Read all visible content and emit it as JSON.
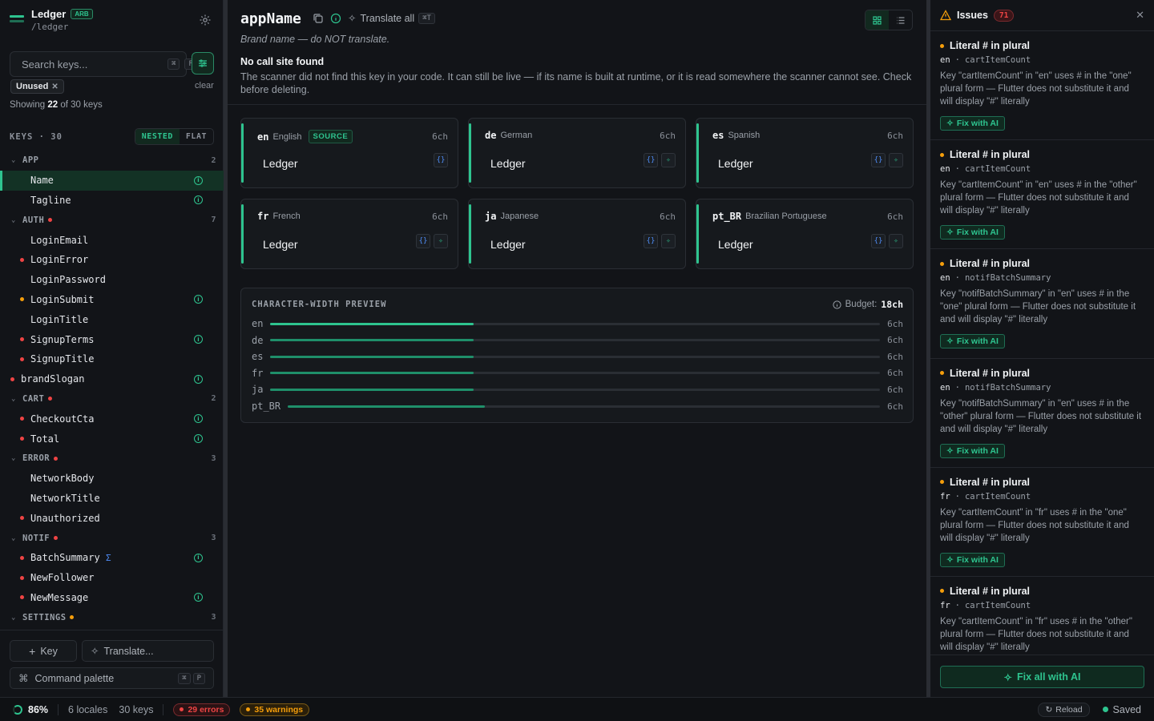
{
  "app": {
    "name": "Ledger",
    "format_badge": "ARB",
    "path": "/ledger"
  },
  "sidebar": {
    "search_placeholder": "Search keys...",
    "search_kbd": [
      "⌘",
      "F"
    ],
    "filter_chip": "Unused",
    "clear_label": "clear",
    "showing_prefix": "Showing",
    "showing_count": "22",
    "showing_suffix": "of 30 keys",
    "keys_label": "KEYS · 30",
    "view_nested": "NESTED",
    "view_flat": "FLAT",
    "tree": [
      {
        "type": "group",
        "label": "APP",
        "count": "2",
        "dot": ""
      },
      {
        "type": "key",
        "label": "Name",
        "indent": 1,
        "dot": "",
        "info": true,
        "active": true
      },
      {
        "type": "key",
        "label": "Tagline",
        "indent": 1,
        "dot": "",
        "info": true
      },
      {
        "type": "group",
        "label": "AUTH",
        "count": "7",
        "dot": "red"
      },
      {
        "type": "key",
        "label": "LoginEmail",
        "indent": 1,
        "dot": ""
      },
      {
        "type": "key",
        "label": "LoginError",
        "indent": 1,
        "dot": "red"
      },
      {
        "type": "key",
        "label": "LoginPassword",
        "indent": 1,
        "dot": ""
      },
      {
        "type": "key",
        "label": "LoginSubmit",
        "indent": 1,
        "dot": "amber",
        "info": true
      },
      {
        "type": "key",
        "label": "LoginTitle",
        "indent": 1,
        "dot": ""
      },
      {
        "type": "key",
        "label": "SignupTerms",
        "indent": 1,
        "dot": "red",
        "info": true
      },
      {
        "type": "key",
        "label": "SignupTitle",
        "indent": 1,
        "dot": "red"
      },
      {
        "type": "key",
        "label": "brandSlogan",
        "indent": 0,
        "dot": "red",
        "info": true
      },
      {
        "type": "group",
        "label": "CART",
        "count": "2",
        "dot": "red"
      },
      {
        "type": "key",
        "label": "CheckoutCta",
        "indent": 1,
        "dot": "red",
        "info": true
      },
      {
        "type": "key",
        "label": "Total",
        "indent": 1,
        "dot": "red",
        "info": true
      },
      {
        "type": "group",
        "label": "ERROR",
        "count": "3",
        "dot": "red"
      },
      {
        "type": "key",
        "label": "NetworkBody",
        "indent": 1,
        "dot": ""
      },
      {
        "type": "key",
        "label": "NetworkTitle",
        "indent": 1,
        "dot": ""
      },
      {
        "type": "key",
        "label": "Unauthorized",
        "indent": 1,
        "dot": "red"
      },
      {
        "type": "group",
        "label": "NOTIF",
        "count": "3",
        "dot": "red"
      },
      {
        "type": "key",
        "label": "BatchSummary",
        "indent": 1,
        "dot": "red",
        "info": true,
        "sigma": "Σ"
      },
      {
        "type": "key",
        "label": "NewFollower",
        "indent": 1,
        "dot": "red"
      },
      {
        "type": "key",
        "label": "NewMessage",
        "indent": 1,
        "dot": "red",
        "info": true
      },
      {
        "type": "group",
        "label": "SETTINGS",
        "count": "3",
        "dot": "amber"
      }
    ],
    "add_key_label": "Key",
    "translate_label": "Translate...",
    "palette_label": "Command palette",
    "palette_kbd": [
      "⌘",
      "P"
    ]
  },
  "main": {
    "key_name": "appName",
    "translate_all_label": "Translate all",
    "translate_all_kbd": "⌘T",
    "description": "Brand name — do NOT translate.",
    "warning_title": "No call site found",
    "warning_body": "The scanner did not find this key in your code. It can still be live — if its name is built at runtime, or it is read somewhere the scanner cannot see. Check before deleting.",
    "locales": [
      {
        "code": "en",
        "name": "English",
        "source": "SOURCE",
        "width": "6ch",
        "value": "Ledger"
      },
      {
        "code": "de",
        "name": "German",
        "source": "",
        "width": "6ch",
        "value": "Ledger"
      },
      {
        "code": "es",
        "name": "Spanish",
        "source": "",
        "width": "6ch",
        "value": "Ledger"
      },
      {
        "code": "fr",
        "name": "French",
        "source": "",
        "width": "6ch",
        "value": "Ledger"
      },
      {
        "code": "ja",
        "name": "Japanese",
        "source": "",
        "width": "6ch",
        "value": "Ledger"
      },
      {
        "code": "pt_BR",
        "name": "Brazilian Portuguese",
        "source": "",
        "width": "6ch",
        "value": "Ledger"
      }
    ],
    "preview": {
      "title": "CHARACTER-WIDTH PREVIEW",
      "budget_label": "Budget:",
      "budget_value": "18ch",
      "budget_ch": 18,
      "rows": [
        {
          "code": "en",
          "width_label": "6ch",
          "width_ch": 6,
          "color": "#2ec48f"
        },
        {
          "code": "de",
          "width_label": "6ch",
          "width_ch": 6,
          "color": "#1f8f6a"
        },
        {
          "code": "es",
          "width_label": "6ch",
          "width_ch": 6,
          "color": "#1f8f6a"
        },
        {
          "code": "fr",
          "width_label": "6ch",
          "width_ch": 6,
          "color": "#1f8f6a"
        },
        {
          "code": "ja",
          "width_label": "6ch",
          "width_ch": 6,
          "color": "#1f8f6a"
        },
        {
          "code": "pt_BR",
          "width_label": "6ch",
          "width_ch": 6,
          "color": "#1f8f6a"
        }
      ]
    }
  },
  "issues": {
    "title": "Issues",
    "count": "71",
    "fix_label": "Fix with AI",
    "fix_all_label": "Fix all with AI",
    "items": [
      {
        "title": "Literal # in plural",
        "locale": "en",
        "key": "cartItemCount",
        "text": "Key \"cartItemCount\" in \"en\" uses # in the \"one\" plural form — Flutter does not substitute it and will display \"#\" literally"
      },
      {
        "title": "Literal # in plural",
        "locale": "en",
        "key": "cartItemCount",
        "text": "Key \"cartItemCount\" in \"en\" uses # in the \"other\" plural form — Flutter does not substitute it and will display \"#\" literally"
      },
      {
        "title": "Literal # in plural",
        "locale": "en",
        "key": "notifBatchSummary",
        "text": "Key \"notifBatchSummary\" in \"en\" uses # in the \"one\" plural form — Flutter does not substitute it and will display \"#\" literally"
      },
      {
        "title": "Literal # in plural",
        "locale": "en",
        "key": "notifBatchSummary",
        "text": "Key \"notifBatchSummary\" in \"en\" uses # in the \"other\" plural form — Flutter does not substitute it and will display \"#\" literally"
      },
      {
        "title": "Literal # in plural",
        "locale": "fr",
        "key": "cartItemCount",
        "text": "Key \"cartItemCount\" in \"fr\" uses # in the \"one\" plural form — Flutter does not substitute it and will display \"#\" literally"
      },
      {
        "title": "Literal # in plural",
        "locale": "fr",
        "key": "cartItemCount",
        "text": "Key \"cartItemCount\" in \"fr\" uses # in the \"other\" plural form — Flutter does not substitute it and will display \"#\" literally"
      }
    ]
  },
  "status": {
    "coverage": "86%",
    "locales": "6 locales",
    "keys": "30 keys",
    "errors": "29 errors",
    "warnings": "35 warnings",
    "reload": "Reload",
    "saved": "Saved"
  }
}
